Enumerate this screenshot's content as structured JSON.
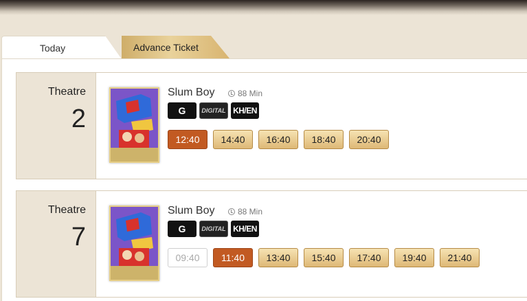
{
  "tabs": {
    "today": "Today",
    "advance": "Advance Ticket"
  },
  "showings": [
    {
      "theatre_label": "Theatre",
      "theatre_number": "2",
      "title": "Slum Boy",
      "duration": "88 Min",
      "badges": {
        "rating": "G",
        "format": "DIGITAL",
        "language": "KH/EN"
      },
      "times": [
        {
          "label": "12:40",
          "state": "selected"
        },
        {
          "label": "14:40",
          "state": "available"
        },
        {
          "label": "16:40",
          "state": "available"
        },
        {
          "label": "18:40",
          "state": "available"
        },
        {
          "label": "20:40",
          "state": "available"
        }
      ]
    },
    {
      "theatre_label": "Theatre",
      "theatre_number": "7",
      "title": "Slum Boy",
      "duration": "88 Min",
      "badges": {
        "rating": "G",
        "format": "DIGITAL",
        "language": "KH/EN"
      },
      "times": [
        {
          "label": "09:40",
          "state": "disabled"
        },
        {
          "label": "11:40",
          "state": "selected"
        },
        {
          "label": "13:40",
          "state": "available"
        },
        {
          "label": "15:40",
          "state": "available"
        },
        {
          "label": "17:40",
          "state": "available"
        },
        {
          "label": "19:40",
          "state": "available"
        },
        {
          "label": "21:40",
          "state": "available"
        }
      ]
    }
  ],
  "icons": {
    "duration": "clock-icon"
  },
  "colors": {
    "selected_time": "#c25a22",
    "available_time": "#deb876",
    "page_background": "#ece4d6"
  }
}
